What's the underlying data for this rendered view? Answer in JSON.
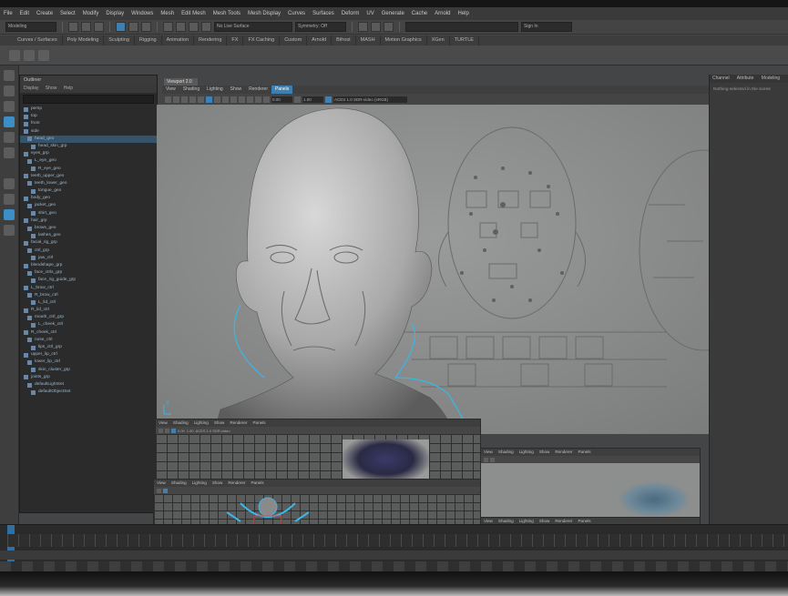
{
  "menubar": {
    "items": [
      "File",
      "Edit",
      "Create",
      "Select",
      "Modify",
      "Display",
      "Windows",
      "Mesh",
      "Edit Mesh",
      "Mesh Tools",
      "Mesh Display",
      "Curves",
      "Surfaces",
      "Deform",
      "UV",
      "Generate",
      "Cache",
      "Arnold",
      "Help"
    ]
  },
  "statusline": {
    "mode": "Modeling",
    "field_surface": "No Live Surface",
    "field_symmetry": "Symmetry: Off",
    "field_input": "",
    "field_right": "Sign In"
  },
  "shelf": {
    "tabs": [
      "Curves / Surfaces",
      "Poly Modeling",
      "Sculpting",
      "Rigging",
      "Animation",
      "Rendering",
      "FX",
      "FX Caching",
      "Custom",
      "Arnold",
      "Bifrost",
      "MASH",
      "Motion Graphics",
      "XGen",
      "TURTLE"
    ]
  },
  "outliner": {
    "title": "Outliner",
    "menus": [
      "Display",
      "Show",
      "Help"
    ],
    "rows": [
      "persp",
      "top",
      "front",
      "side",
      "head_geo",
      "head_skin_grp",
      "eyes_grp",
      "L_eye_geo",
      "R_eye_geo",
      "teeth_upper_geo",
      "teeth_lower_geo",
      "tongue_geo",
      "body_geo",
      "jacket_geo",
      "shirt_geo",
      "hair_grp",
      "brows_geo",
      "lashes_geo",
      "facial_rig_grp",
      "ctrl_grp",
      "jaw_ctrl",
      "blendshape_grp",
      "face_ctrls_grp",
      "face_rig_guide_grp",
      "L_brow_ctrl",
      "R_brow_ctrl",
      "L_lid_ctrl",
      "R_lid_ctrl",
      "mouth_ctrl_grp",
      "L_cheek_ctrl",
      "R_cheek_ctrl",
      "nose_ctrl",
      "lips_ctrl_grp",
      "upper_lip_ctrl",
      "lower_lip_ctrl",
      "skin_cluster_grp",
      "joints_grp",
      "defaultLightSet",
      "defaultObjectSet"
    ]
  },
  "viewport": {
    "tab": "Viewport 2.0",
    "menus": [
      "View",
      "Shading",
      "Lighting",
      "Show",
      "Renderer",
      "Panels"
    ],
    "field_a": "0.00",
    "field_b": "1.00",
    "color_space": "ACES 1.0 SDR-video (sRGB)",
    "corner_label": "Y"
  },
  "right_panel": {
    "tabs": [
      "Channel",
      "Attribute",
      "Modeling"
    ],
    "text": "Nothing selected in the scene"
  },
  "subpanels": {
    "menus": [
      "View",
      "Shading",
      "Lighting",
      "Show",
      "Renderer",
      "Panels"
    ],
    "color_space": "ACES 1.0 SDR-video",
    "field_a": "0.00",
    "field_b": "1.00"
  },
  "colors": {
    "accent": "#3c8ec6",
    "curve": "#39b7e6",
    "viewport_bg": "#7f8080"
  }
}
